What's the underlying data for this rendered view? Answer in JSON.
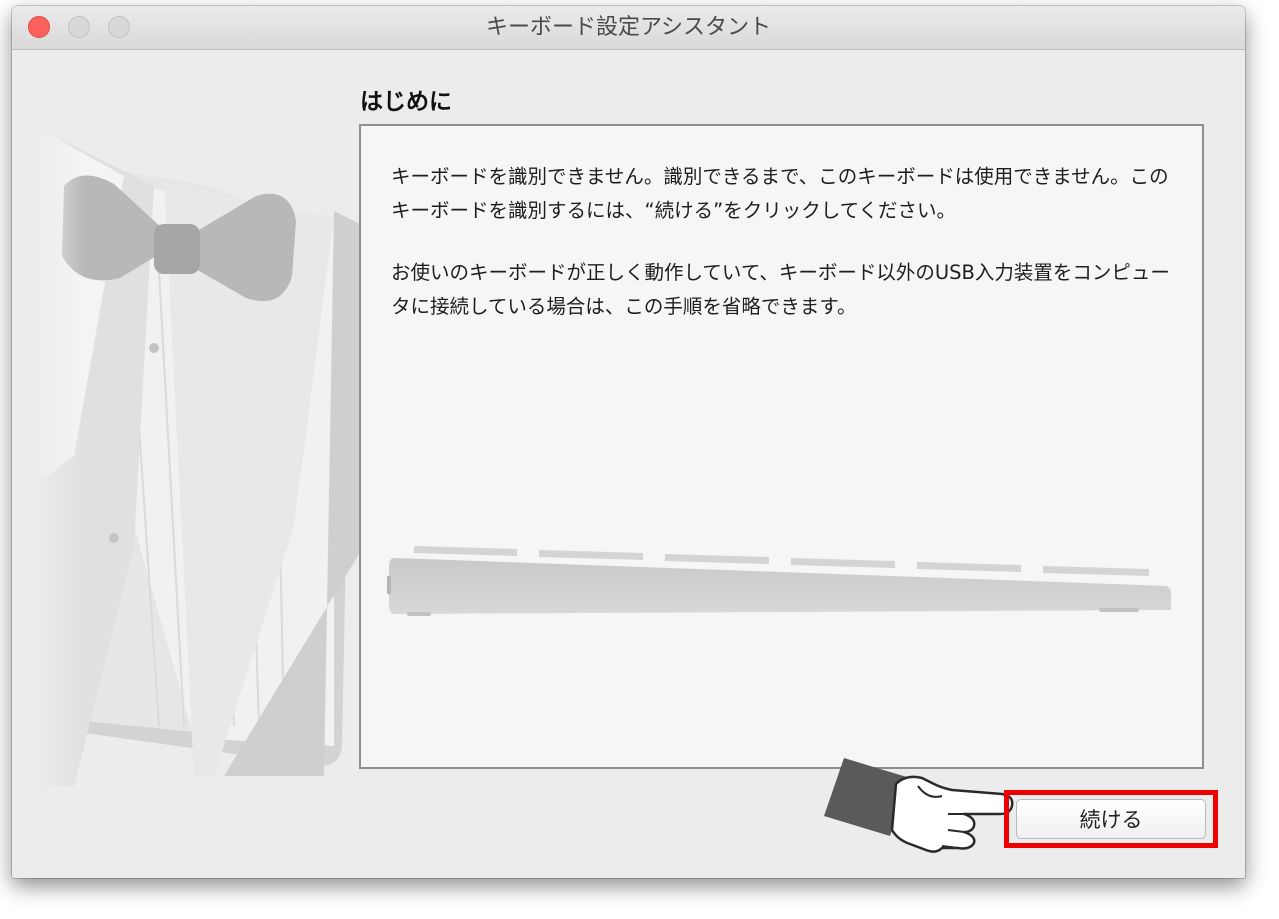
{
  "window": {
    "title": "キーボード設定アシスタント"
  },
  "section": {
    "title": "はじめに"
  },
  "content": {
    "paragraph1": "キーボードを識別できません。識別できるまで、このキーボードは使用できません。このキーボードを識別するには、“続ける”をクリックしてください。",
    "paragraph2": "お使いのキーボードが正しく動作していて、キーボード以外のUSB入力装置をコンピュータに接続している場合は、この手順を省略できます。"
  },
  "buttons": {
    "continue_label": "続ける"
  },
  "icons": {
    "close": "close-button-icon",
    "minimize": "minimize-button-icon",
    "zoom": "zoom-button-icon",
    "butler_art": "butler-tuxedo-illustration",
    "keyboard": "keyboard-illustration",
    "pointer": "pointing-hand-icon"
  },
  "colors": {
    "close_button": "#fc605c",
    "highlight": "#ee0000",
    "window_bg": "#ececec"
  }
}
